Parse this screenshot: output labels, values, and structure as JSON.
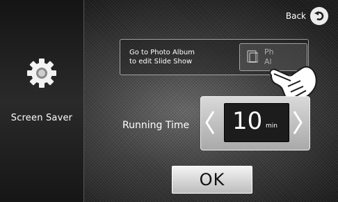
{
  "sidebar": {
    "label": "Screen Saver",
    "icon": "gear-icon"
  },
  "header": {
    "back_label": "Back",
    "back_icon": "back-arrow-icon"
  },
  "album": {
    "hint_line1": "Go to Photo Album",
    "hint_line2": "to edit Slide Show",
    "button_line1": "Ph",
    "button_line2": "Al",
    "button_icon": "photo-album-icon"
  },
  "running_time": {
    "label": "Running Time",
    "value": "10",
    "unit": "min"
  },
  "footer": {
    "ok_label": "OK"
  }
}
